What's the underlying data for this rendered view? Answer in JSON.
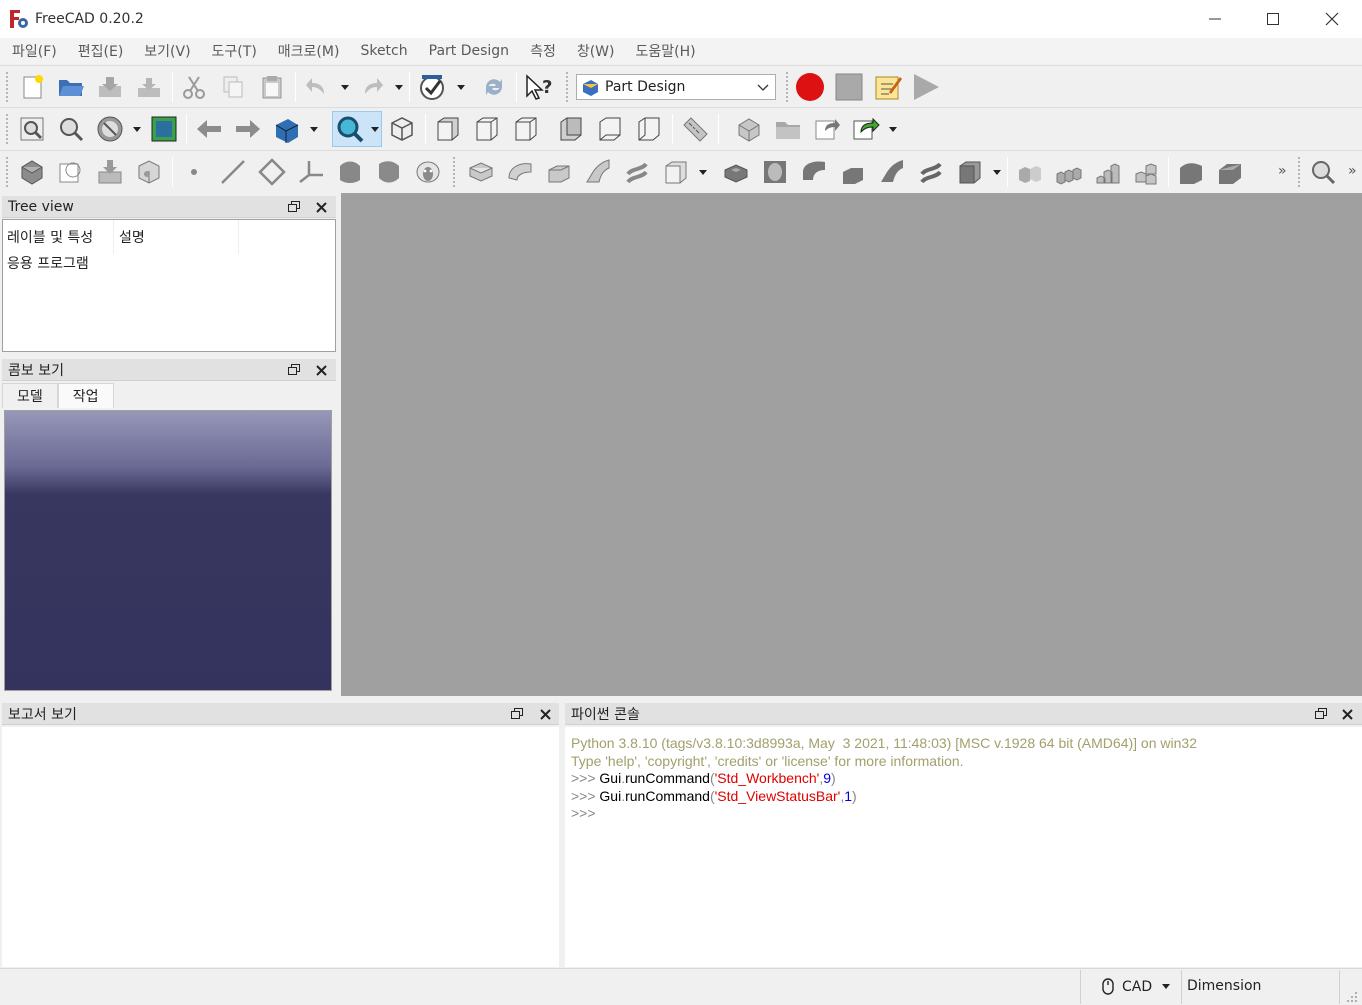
{
  "window": {
    "title": "FreeCAD 0.20.2",
    "minimize_icon": "minimize-icon",
    "maximize_icon": "maximize-icon",
    "close_icon": "close-icon"
  },
  "menu": [
    "파일(F)",
    "편집(E)",
    "보기(V)",
    "도구(T)",
    "매크로(M)",
    "Sketch",
    "Part Design",
    "측정",
    "창(W)",
    "도움말(H)"
  ],
  "workbench": {
    "selected": "Part Design"
  },
  "tree_view": {
    "title": "Tree view",
    "col1": "레이블 및 특성",
    "col2": "설명",
    "item": "응용 프로그램"
  },
  "combo_view": {
    "title": "콤보 보기",
    "tabs": [
      "모델",
      "작업"
    ]
  },
  "report_view": {
    "title": "보고서 보기"
  },
  "python_console": {
    "title": "파이썬 콘솔",
    "line1": "Python 3.8.10 (tags/v3.8.10:3d8993a, May  3 2021, 11:48:03) [MSC v.1928 64 bit (AMD64)] on win32",
    "line2": "Type 'help', 'copyright', 'credits' or 'license' for more information.",
    "prompt": ">>> ",
    "cmd_prefix": "Gui",
    "cmd_dot": ".",
    "cmd_name": "runCommand",
    "open": "(",
    "close": ")",
    "comma": ",",
    "cmd1_arg": "'Std_Workbench'",
    "cmd1_num": "9",
    "cmd2_arg": "'Std_ViewStatusBar'",
    "cmd2_num": "1"
  },
  "status": {
    "nav_style": "CAD",
    "units": "Dimension"
  },
  "colors": {
    "record": "#dd1111",
    "console_info": "#a39f6c",
    "string": "#e00000",
    "number": "#0000e0"
  }
}
